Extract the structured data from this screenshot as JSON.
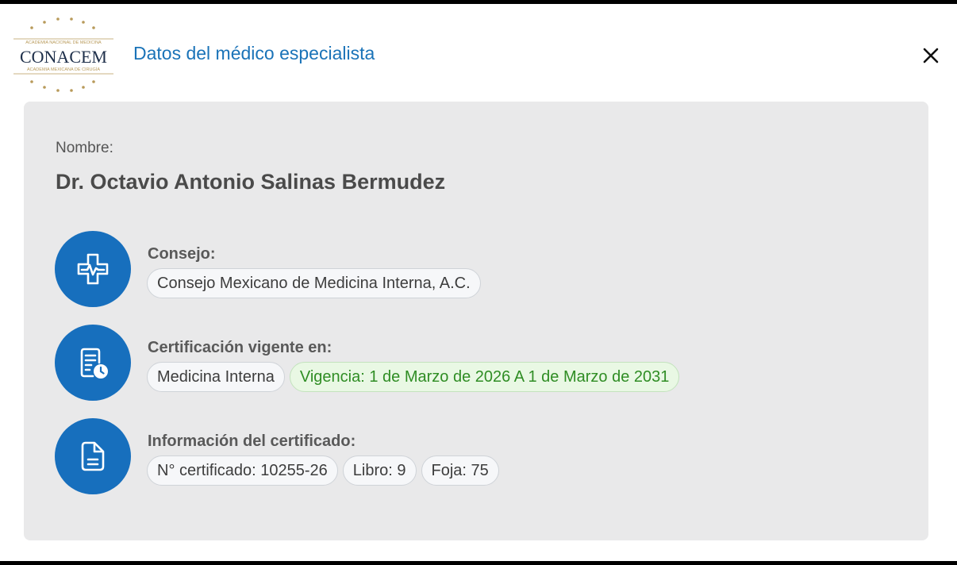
{
  "header": {
    "title": "Datos del médico especialista",
    "logo": {
      "top_text": "ACADEMIA NACIONAL DE MEDICINA",
      "name": "CONACEM",
      "bottom_text": "ACADEMIA MEXICANA DE CIRUGÍA"
    },
    "close_icon": "close-icon"
  },
  "doctor": {
    "name_label": "Nombre:",
    "name": "Dr. Octavio Antonio Salinas Bermudez"
  },
  "consejo": {
    "icon": "medical-cross-icon",
    "label": "Consejo:",
    "value": "Consejo Mexicano de Medicina Interna, A.C."
  },
  "certificacion": {
    "icon": "certificate-clock-icon",
    "label": "Certificación vigente en:",
    "specialty": "Medicina Interna",
    "vigencia": "Vigencia: 1 de Marzo de 2026 A 1 de Marzo de 2031"
  },
  "certificado": {
    "icon": "document-icon",
    "label": "Información del certificado:",
    "numero": "N° certificado: 10255-26",
    "libro": "Libro: 9",
    "foja": "Foja: 75"
  },
  "colors": {
    "accent": "#1a73b8",
    "icon_circle": "#176fbd",
    "card_bg": "#e9e9ea",
    "vigencia_text": "#2f8d24",
    "logo_gold": "#b89a5a"
  }
}
